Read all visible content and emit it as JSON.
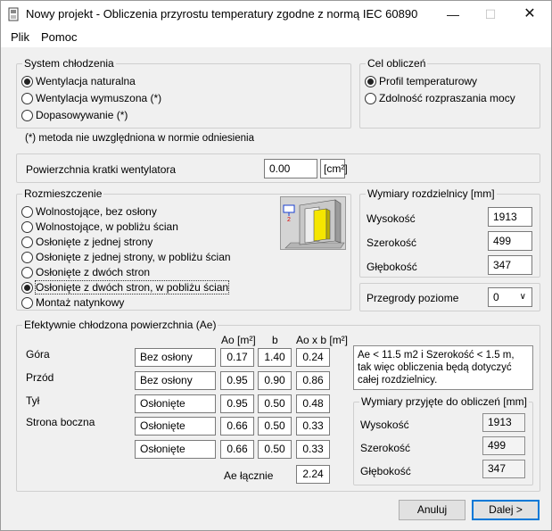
{
  "window": {
    "title": "Nowy projekt - Obliczenia przyrostu temperatury zgodne z normą IEC 60890"
  },
  "menu": [
    "Plik",
    "Pomoc"
  ],
  "cooling": {
    "label": "System chłodzenia",
    "options": [
      "Wentylacja naturalna",
      "Wentylacja wymuszona (*)",
      "Dopasowywanie (*)"
    ],
    "selected": 0,
    "note": "(*) metoda nie uwzględniona w normie odniesienia"
  },
  "goal": {
    "label": "Cel obliczeń",
    "options": [
      "Profil temperaturowy",
      "Zdolność rozpraszania mocy"
    ],
    "selected": 0
  },
  "vent": {
    "label": "Powierzchnia kratki wentylatora",
    "value": "0.00",
    "unit": "[cm²]"
  },
  "placement": {
    "label": "Rozmieszczenie",
    "options": [
      "Wolnostojące, bez osłony",
      "Wolnostojące, w pobliżu ścian",
      "Osłonięte z jednej strony",
      "Osłonięte z jednej strony, w pobliżu ścian",
      "Osłonięte z dwóch stron",
      "Osłonięte z dwóch stron, w pobliżu ścian",
      "Montaż natynkowy"
    ],
    "selected": 5
  },
  "dims": {
    "label": "Wymiary rozdzielnicy [mm]",
    "height_label": "Wysokość",
    "height": "1913",
    "width_label": "Szerokość",
    "width": "499",
    "depth_label": "Głębokość",
    "depth": "347"
  },
  "partitions": {
    "label": "Przegrody poziome",
    "value": "0"
  },
  "ae": {
    "label": "Efektywnie chłodzona powierzchnia (Ae)",
    "headers": {
      "ao": "Ao [m²]",
      "b": "b",
      "aob": "Ao x b [m²]"
    },
    "side_labels": [
      "Góra",
      "Przód",
      "Tył",
      "Strona boczna"
    ],
    "rows": [
      {
        "cover": "Bez osłony",
        "ao": "0.17",
        "b": "1.40",
        "aob": "0.24"
      },
      {
        "cover": "Bez osłony",
        "ao": "0.95",
        "b": "0.90",
        "aob": "0.86"
      },
      {
        "cover": "Osłonięte",
        "ao": "0.95",
        "b": "0.50",
        "aob": "0.48"
      },
      {
        "cover": "Osłonięte",
        "ao": "0.66",
        "b": "0.50",
        "aob": "0.33"
      },
      {
        "cover": "Osłonięte",
        "ao": "0.66",
        "b": "0.50",
        "aob": "0.33"
      }
    ],
    "total_label": "Ae łącznie",
    "total": "2.24",
    "note": "Ae < 11.5 m2 i Szerokość < 1.5 m, tak więc obliczenia będą dotyczyć całej rozdzielnicy."
  },
  "used_dims": {
    "label": "Wymiary przyjęte do obliczeń [mm]",
    "height_label": "Wysokość",
    "height": "1913",
    "width_label": "Szerokość",
    "width": "499",
    "depth_label": "Głębokość",
    "depth": "347"
  },
  "buttons": {
    "cancel": "Anuluj",
    "next": "Dalej >"
  },
  "colors": {
    "accent": "#0078d7",
    "cabinet_yellow": "#f5e600"
  }
}
